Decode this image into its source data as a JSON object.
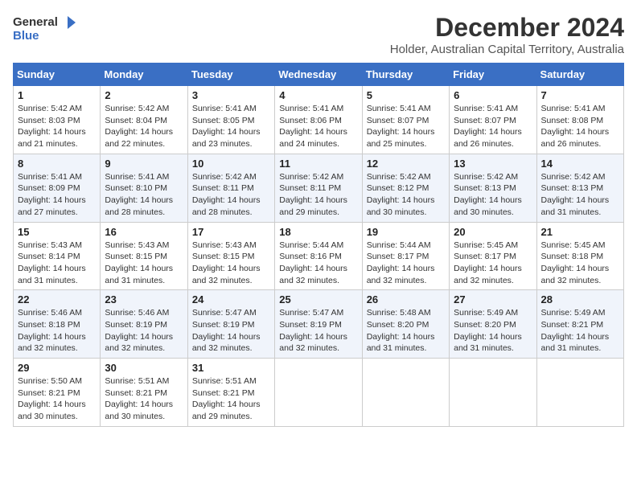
{
  "logo": {
    "line1": "General",
    "line2": "Blue"
  },
  "title": "December 2024",
  "subtitle": "Holder, Australian Capital Territory, Australia",
  "days_header": [
    "Sunday",
    "Monday",
    "Tuesday",
    "Wednesday",
    "Thursday",
    "Friday",
    "Saturday"
  ],
  "weeks": [
    [
      {
        "day": "1",
        "sunrise": "Sunrise: 5:42 AM",
        "sunset": "Sunset: 8:03 PM",
        "daylight": "Daylight: 14 hours and 21 minutes."
      },
      {
        "day": "2",
        "sunrise": "Sunrise: 5:42 AM",
        "sunset": "Sunset: 8:04 PM",
        "daylight": "Daylight: 14 hours and 22 minutes."
      },
      {
        "day": "3",
        "sunrise": "Sunrise: 5:41 AM",
        "sunset": "Sunset: 8:05 PM",
        "daylight": "Daylight: 14 hours and 23 minutes."
      },
      {
        "day": "4",
        "sunrise": "Sunrise: 5:41 AM",
        "sunset": "Sunset: 8:06 PM",
        "daylight": "Daylight: 14 hours and 24 minutes."
      },
      {
        "day": "5",
        "sunrise": "Sunrise: 5:41 AM",
        "sunset": "Sunset: 8:07 PM",
        "daylight": "Daylight: 14 hours and 25 minutes."
      },
      {
        "day": "6",
        "sunrise": "Sunrise: 5:41 AM",
        "sunset": "Sunset: 8:07 PM",
        "daylight": "Daylight: 14 hours and 26 minutes."
      },
      {
        "day": "7",
        "sunrise": "Sunrise: 5:41 AM",
        "sunset": "Sunset: 8:08 PM",
        "daylight": "Daylight: 14 hours and 26 minutes."
      }
    ],
    [
      {
        "day": "8",
        "sunrise": "Sunrise: 5:41 AM",
        "sunset": "Sunset: 8:09 PM",
        "daylight": "Daylight: 14 hours and 27 minutes."
      },
      {
        "day": "9",
        "sunrise": "Sunrise: 5:41 AM",
        "sunset": "Sunset: 8:10 PM",
        "daylight": "Daylight: 14 hours and 28 minutes."
      },
      {
        "day": "10",
        "sunrise": "Sunrise: 5:42 AM",
        "sunset": "Sunset: 8:11 PM",
        "daylight": "Daylight: 14 hours and 28 minutes."
      },
      {
        "day": "11",
        "sunrise": "Sunrise: 5:42 AM",
        "sunset": "Sunset: 8:11 PM",
        "daylight": "Daylight: 14 hours and 29 minutes."
      },
      {
        "day": "12",
        "sunrise": "Sunrise: 5:42 AM",
        "sunset": "Sunset: 8:12 PM",
        "daylight": "Daylight: 14 hours and 30 minutes."
      },
      {
        "day": "13",
        "sunrise": "Sunrise: 5:42 AM",
        "sunset": "Sunset: 8:13 PM",
        "daylight": "Daylight: 14 hours and 30 minutes."
      },
      {
        "day": "14",
        "sunrise": "Sunrise: 5:42 AM",
        "sunset": "Sunset: 8:13 PM",
        "daylight": "Daylight: 14 hours and 31 minutes."
      }
    ],
    [
      {
        "day": "15",
        "sunrise": "Sunrise: 5:43 AM",
        "sunset": "Sunset: 8:14 PM",
        "daylight": "Daylight: 14 hours and 31 minutes."
      },
      {
        "day": "16",
        "sunrise": "Sunrise: 5:43 AM",
        "sunset": "Sunset: 8:15 PM",
        "daylight": "Daylight: 14 hours and 31 minutes."
      },
      {
        "day": "17",
        "sunrise": "Sunrise: 5:43 AM",
        "sunset": "Sunset: 8:15 PM",
        "daylight": "Daylight: 14 hours and 32 minutes."
      },
      {
        "day": "18",
        "sunrise": "Sunrise: 5:44 AM",
        "sunset": "Sunset: 8:16 PM",
        "daylight": "Daylight: 14 hours and 32 minutes."
      },
      {
        "day": "19",
        "sunrise": "Sunrise: 5:44 AM",
        "sunset": "Sunset: 8:17 PM",
        "daylight": "Daylight: 14 hours and 32 minutes."
      },
      {
        "day": "20",
        "sunrise": "Sunrise: 5:45 AM",
        "sunset": "Sunset: 8:17 PM",
        "daylight": "Daylight: 14 hours and 32 minutes."
      },
      {
        "day": "21",
        "sunrise": "Sunrise: 5:45 AM",
        "sunset": "Sunset: 8:18 PM",
        "daylight": "Daylight: 14 hours and 32 minutes."
      }
    ],
    [
      {
        "day": "22",
        "sunrise": "Sunrise: 5:46 AM",
        "sunset": "Sunset: 8:18 PM",
        "daylight": "Daylight: 14 hours and 32 minutes."
      },
      {
        "day": "23",
        "sunrise": "Sunrise: 5:46 AM",
        "sunset": "Sunset: 8:19 PM",
        "daylight": "Daylight: 14 hours and 32 minutes."
      },
      {
        "day": "24",
        "sunrise": "Sunrise: 5:47 AM",
        "sunset": "Sunset: 8:19 PM",
        "daylight": "Daylight: 14 hours and 32 minutes."
      },
      {
        "day": "25",
        "sunrise": "Sunrise: 5:47 AM",
        "sunset": "Sunset: 8:19 PM",
        "daylight": "Daylight: 14 hours and 32 minutes."
      },
      {
        "day": "26",
        "sunrise": "Sunrise: 5:48 AM",
        "sunset": "Sunset: 8:20 PM",
        "daylight": "Daylight: 14 hours and 31 minutes."
      },
      {
        "day": "27",
        "sunrise": "Sunrise: 5:49 AM",
        "sunset": "Sunset: 8:20 PM",
        "daylight": "Daylight: 14 hours and 31 minutes."
      },
      {
        "day": "28",
        "sunrise": "Sunrise: 5:49 AM",
        "sunset": "Sunset: 8:21 PM",
        "daylight": "Daylight: 14 hours and 31 minutes."
      }
    ],
    [
      {
        "day": "29",
        "sunrise": "Sunrise: 5:50 AM",
        "sunset": "Sunset: 8:21 PM",
        "daylight": "Daylight: 14 hours and 30 minutes."
      },
      {
        "day": "30",
        "sunrise": "Sunrise: 5:51 AM",
        "sunset": "Sunset: 8:21 PM",
        "daylight": "Daylight: 14 hours and 30 minutes."
      },
      {
        "day": "31",
        "sunrise": "Sunrise: 5:51 AM",
        "sunset": "Sunset: 8:21 PM",
        "daylight": "Daylight: 14 hours and 29 minutes."
      },
      null,
      null,
      null,
      null
    ]
  ]
}
